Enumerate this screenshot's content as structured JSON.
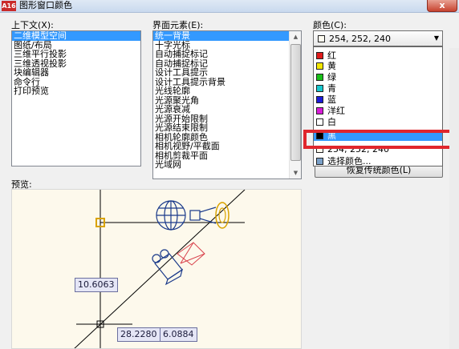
{
  "window": {
    "title": "图形窗口颜色",
    "app_icon": "A16",
    "close_label": "x"
  },
  "context": {
    "label": "上下文(X):",
    "items": [
      "二维模型空间",
      "图纸/布局",
      "三维平行投影",
      "三维透视投影",
      "块编辑器",
      "命令行",
      "打印预览"
    ],
    "selected_index": 0
  },
  "elements": {
    "label": "界面元素(E):",
    "items": [
      "统一背景",
      "十字光标",
      "自动捕捉标记",
      "自动捕捉标记",
      "设计工具提示",
      "设计工具提示背景",
      "光线轮廓",
      "光源聚光角",
      "光源衰减",
      "光源开始限制",
      "光源结束限制",
      "相机轮廓颜色",
      "相机视野/平截面",
      "相机剪裁平面",
      "光域网"
    ],
    "selected_index": 0
  },
  "color": {
    "label": "颜色(C):",
    "current_value": "254, 252, 240",
    "current_swatch": "#fefcf0",
    "dropdown_items": [
      {
        "label": "红",
        "swatch": "#e01b1b"
      },
      {
        "label": "黄",
        "swatch": "#f2e600"
      },
      {
        "label": "绿",
        "swatch": "#19c019"
      },
      {
        "label": "青",
        "swatch": "#18c8cf"
      },
      {
        "label": "蓝",
        "swatch": "#1b1bd8"
      },
      {
        "label": "洋红",
        "swatch": "#d81bd8"
      },
      {
        "label": "白",
        "swatch": "#ffffff"
      },
      {
        "label": "黑",
        "swatch": "#000000"
      },
      {
        "label": "254, 252, 240",
        "swatch": "#fefcf0"
      },
      {
        "label": "选择颜色...",
        "swatch": "#7aa0c8"
      }
    ],
    "selected_index": 7
  },
  "restore_button": {
    "label": "恢复传统颜色(L)"
  },
  "preview": {
    "label": "预览:",
    "dim_vertical": "10.6063",
    "dim_x": "28.2280",
    "dim_y": "6.0884"
  },
  "colors": {
    "highlight": "#e0262d",
    "selection": "#3399ff",
    "preview_bg": "#fdf9ec"
  }
}
